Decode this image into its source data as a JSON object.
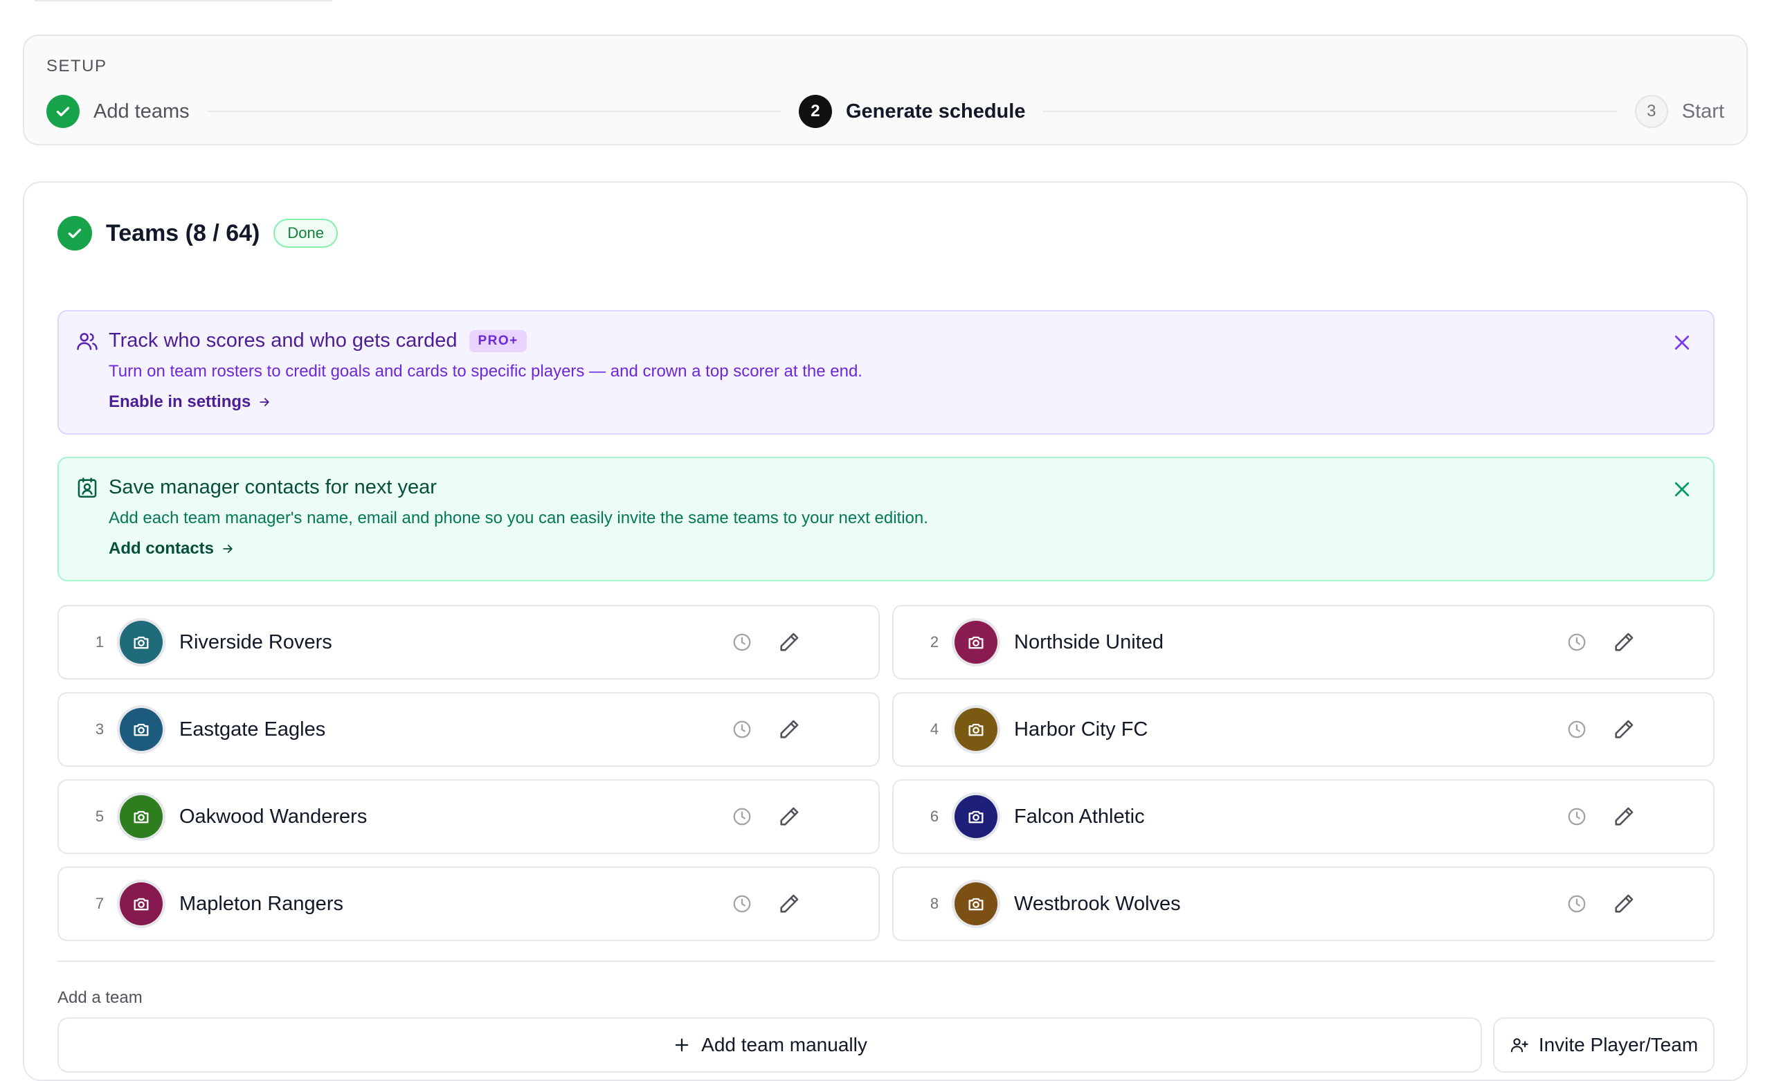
{
  "stepper": {
    "section_label": "SETUP",
    "steps": [
      {
        "number": "",
        "label": "Add teams",
        "state": "done"
      },
      {
        "number": "2",
        "label": "Generate schedule",
        "state": "current"
      },
      {
        "number": "3",
        "label": "Start",
        "state": "pending"
      }
    ]
  },
  "teams_section": {
    "title": "Teams (8 / 64)",
    "status_badge": "Done"
  },
  "banners": {
    "rosters": {
      "title": "Track who scores and who gets carded",
      "badge": "PRO+",
      "description": "Turn on team rosters to credit goals and cards to specific players — and crown a top scorer at the end.",
      "link": "Enable in settings",
      "icon": "users-icon"
    },
    "contacts": {
      "title": "Save manager contacts for next year",
      "description": "Add each team manager's name, email and phone so you can easily invite the same teams to your next edition.",
      "link": "Add contacts",
      "icon": "contact-card-icon"
    }
  },
  "teams": [
    {
      "number": "1",
      "name": "Riverside Rovers",
      "color": "#1f6b7a"
    },
    {
      "number": "2",
      "name": "Northside United",
      "color": "#8a1c52"
    },
    {
      "number": "3",
      "name": "Eastgate Eagles",
      "color": "#1d5b7e"
    },
    {
      "number": "4",
      "name": "Harbor City FC",
      "color": "#7a5a12"
    },
    {
      "number": "5",
      "name": "Oakwood Wanderers",
      "color": "#2e7d1f"
    },
    {
      "number": "6",
      "name": "Falcon Athletic",
      "color": "#1e1f78"
    },
    {
      "number": "7",
      "name": "Mapleton Rangers",
      "color": "#861a4e"
    },
    {
      "number": "8",
      "name": "Westbrook Wolves",
      "color": "#7c4f14"
    }
  ],
  "add_team": {
    "label": "Add a team",
    "manual_button": "Add team manually",
    "invite_button": "Invite Player/Team"
  },
  "colors": {
    "success": "#16a34a",
    "pro_purple": "#6d28d9",
    "contact_green": "#059669"
  }
}
